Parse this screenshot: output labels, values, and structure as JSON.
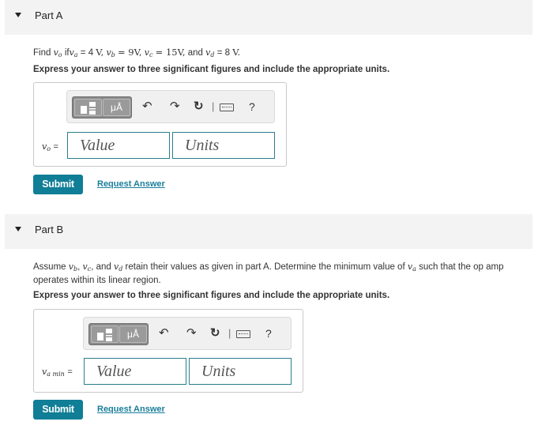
{
  "partA": {
    "title": "Part A",
    "prompt": {
      "find": "Find",
      "vo": "v",
      "vo_sub": "o",
      "if": "if",
      "va": "v",
      "va_sub": "a",
      "va_val": "= 4",
      "va_unit": "V,",
      "vb": "v",
      "vb_sub": "b",
      "vb_val": "= 9V,",
      "vc": "v",
      "vc_sub": "c",
      "vc_val": "= 15V,",
      "and": "and",
      "vd": "v",
      "vd_sub": "d",
      "vd_val": "= 8",
      "vd_unit": "V."
    },
    "instructions": "Express your answer to three significant figures and include the appropriate units.",
    "variable": "v",
    "variable_sub": "o",
    "equals": "=",
    "value_placeholder": "Value",
    "units_placeholder": "Units",
    "submit_label": "Submit",
    "request_label": "Request Answer"
  },
  "partB": {
    "title": "Part B",
    "prompt_line1": {
      "assume": "Assume",
      "vb": "v",
      "vb_sub": "b",
      "comma1": ",",
      "vc": "v",
      "vc_sub": "c",
      "comma2": ", and",
      "vd": "v",
      "vd_sub": "d",
      "rest": "retain their values as given in part A. Determine the minimum value of",
      "va": "v",
      "va_sub": "a",
      "tail": "such that the op amp"
    },
    "prompt_line2": "operates within its linear region.",
    "instructions": "Express your answer to three significant figures and include the appropriate units.",
    "variable": "v",
    "variable_sub": "a min",
    "equals": "=",
    "value_placeholder": "Value",
    "units_placeholder": "Units",
    "submit_label": "Submit",
    "request_label": "Request Answer"
  },
  "toolbar": {
    "template_icon": "fraction-template-icon",
    "units_button": "μÅ",
    "undo_icon": "↶",
    "redo_icon": "↷",
    "reset_icon": "↻",
    "separator": "|",
    "help": "?"
  },
  "colors": {
    "accent": "#0f7e96",
    "field_border": "#2a7e8e",
    "header_bg": "#f3f3f3"
  }
}
